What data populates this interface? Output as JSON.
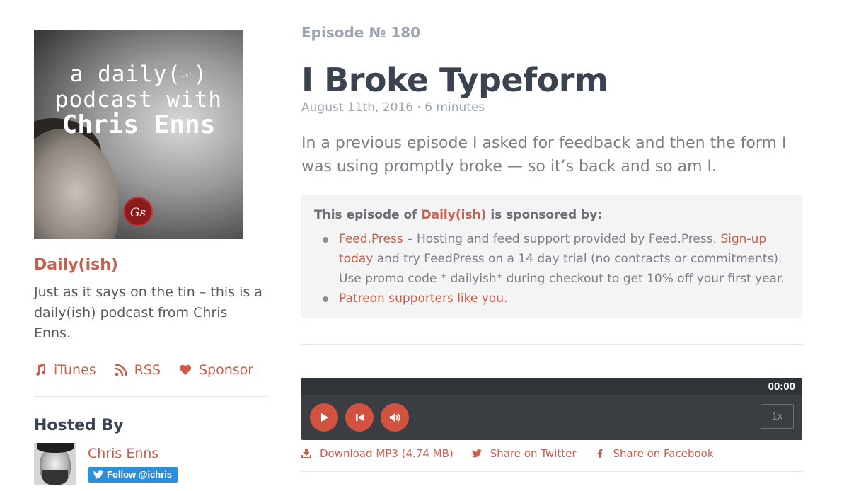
{
  "cover": {
    "line1": "a daily(",
    "ish": "ish",
    "line1_end": ")",
    "line2": "podcast with",
    "line3": "Chris Enns",
    "badge": "Gs"
  },
  "sidebar": {
    "show_title": "Daily(ish)",
    "description": "Just as it says on the tin – this is a daily(ish) podcast from Chris Enns.",
    "links": [
      {
        "label": "iTunes",
        "icon": "music-note-icon"
      },
      {
        "label": "RSS",
        "icon": "rss-icon"
      },
      {
        "label": "Sponsor",
        "icon": "heart-icon"
      }
    ],
    "hosted_by_title": "Hosted By",
    "host": {
      "name": "Chris Enns",
      "follow_label": "Follow @ichris"
    }
  },
  "episode": {
    "number": "Episode № 180",
    "title": "I Broke Typeform",
    "meta": "August 11th, 2016 · 6 minutes",
    "summary": "In a previous episode I asked for feedback and then the form I was using promptly broke — so it’s back and so am I.",
    "sponsor": {
      "head_prefix": "This episode of ",
      "head_show": "Daily(ish)",
      "head_suffix": " is sponsored by:",
      "item1_link": "Feed.Press",
      "item1_text": " – Hosting and feed support provided by Feed.Press. ",
      "item1_link2": "Sign-up today",
      "item1_text2": " and try FeedPress on a 14 day trial (no contracts or commitments). Use promo code * dailyish* during checkout to get 10% off your first year.",
      "item2_link": "Patreon supporters like you."
    }
  },
  "player": {
    "time": "00:00",
    "speed": "1x"
  },
  "actions": {
    "download": "Download MP3 (4.74 MB)",
    "twitter": "Share on Twitter",
    "facebook": "Share on Facebook"
  },
  "colors": {
    "accent": "#c85f4c",
    "heading": "#3b4350",
    "muted": "#9ea4ae",
    "player_bg": "#3a3e43",
    "player_button": "#d1533f",
    "twitter_blue": "#2b90d9"
  }
}
